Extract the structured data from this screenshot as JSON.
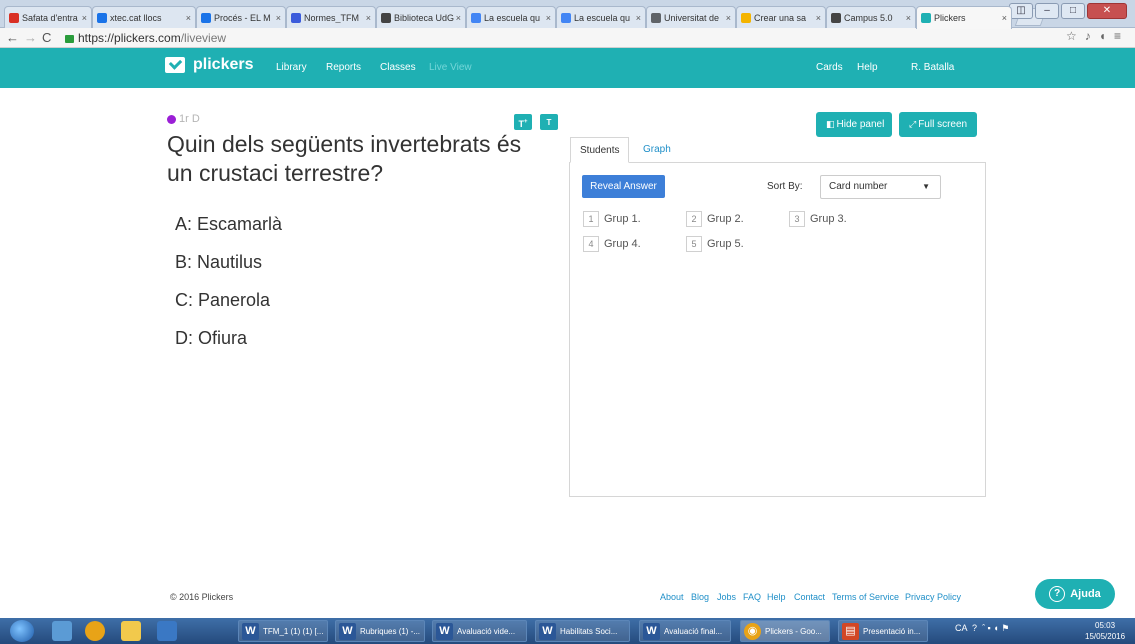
{
  "browser": {
    "tabs": [
      {
        "label": "Safata d'entra",
        "color": "#d93025"
      },
      {
        "label": "xtec.cat llocs",
        "color": "#1a73e8"
      },
      {
        "label": "Procés - EL M",
        "color": "#1a73e8"
      },
      {
        "label": "Normes_TFM",
        "color": "#3b5bdb"
      },
      {
        "label": "Biblioteca UdG",
        "color": "#444444"
      },
      {
        "label": "La escuela qu",
        "color": "#4285f4"
      },
      {
        "label": "La escuela qu",
        "color": "#4285f4"
      },
      {
        "label": "Universitat de",
        "color": "#5f6368"
      },
      {
        "label": "Crear una sa",
        "color": "#f4b400"
      },
      {
        "label": "Campus 5.0",
        "color": "#444444"
      },
      {
        "label": "Plickers",
        "color": "#1fb0b3"
      }
    ],
    "url_host": "https://plickers.com",
    "url_path": "/liveview"
  },
  "nav": {
    "brand": "plickers",
    "links": [
      "Library",
      "Reports",
      "Classes",
      "Live View"
    ],
    "right": [
      "Cards",
      "Help",
      "R. Batalla"
    ]
  },
  "question": {
    "class_name": "1r D",
    "class_color": "#9b1fd6",
    "text": "Quin dels següents invertebrats és un crustaci terrestre?",
    "answers": [
      "A: Escamarlà",
      "B: Nautilus",
      "C: Panerola",
      "D: Ofiura"
    ],
    "size_up": "T",
    "size_down": "T"
  },
  "panel": {
    "hide_label": "Hide panel",
    "fullscreen_label": "Full screen",
    "tabs": [
      "Students",
      "Graph"
    ],
    "reveal_label": "Reveal Answer",
    "sort_label": "Sort By:",
    "sort_value": "Card number",
    "groups": [
      {
        "num": "1",
        "name": "Grup 1."
      },
      {
        "num": "2",
        "name": "Grup 2."
      },
      {
        "num": "3",
        "name": "Grup 3."
      },
      {
        "num": "4",
        "name": "Grup 4."
      },
      {
        "num": "5",
        "name": "Grup 5."
      }
    ]
  },
  "footer": {
    "copyright": "© 2016 Plickers",
    "links": [
      "About",
      "Blog",
      "Jobs",
      "FAQ",
      "Help",
      "Contact",
      "Terms of Service",
      "Privacy Policy"
    ],
    "help_button": "Ajuda"
  },
  "taskbar": {
    "buttons": [
      {
        "label": "TFM_1 (1) (1) [...",
        "icon": "W",
        "color": "#2b5797"
      },
      {
        "label": "Rubriques (1) -...",
        "icon": "W",
        "color": "#2b5797"
      },
      {
        "label": "Avaluació vide...",
        "icon": "W",
        "color": "#2b5797"
      },
      {
        "label": "Habilitats Soci...",
        "icon": "W",
        "color": "#2b5797"
      },
      {
        "label": "Avaluació final...",
        "icon": "W",
        "color": "#2b5797"
      },
      {
        "label": "Plickers - Goo...",
        "icon": "◉",
        "color": "#e8a317"
      },
      {
        "label": "Presentació in...",
        "icon": "▤",
        "color": "#d24726"
      }
    ],
    "lang": "CA",
    "time": "05:03",
    "date": "15/05/2016"
  }
}
